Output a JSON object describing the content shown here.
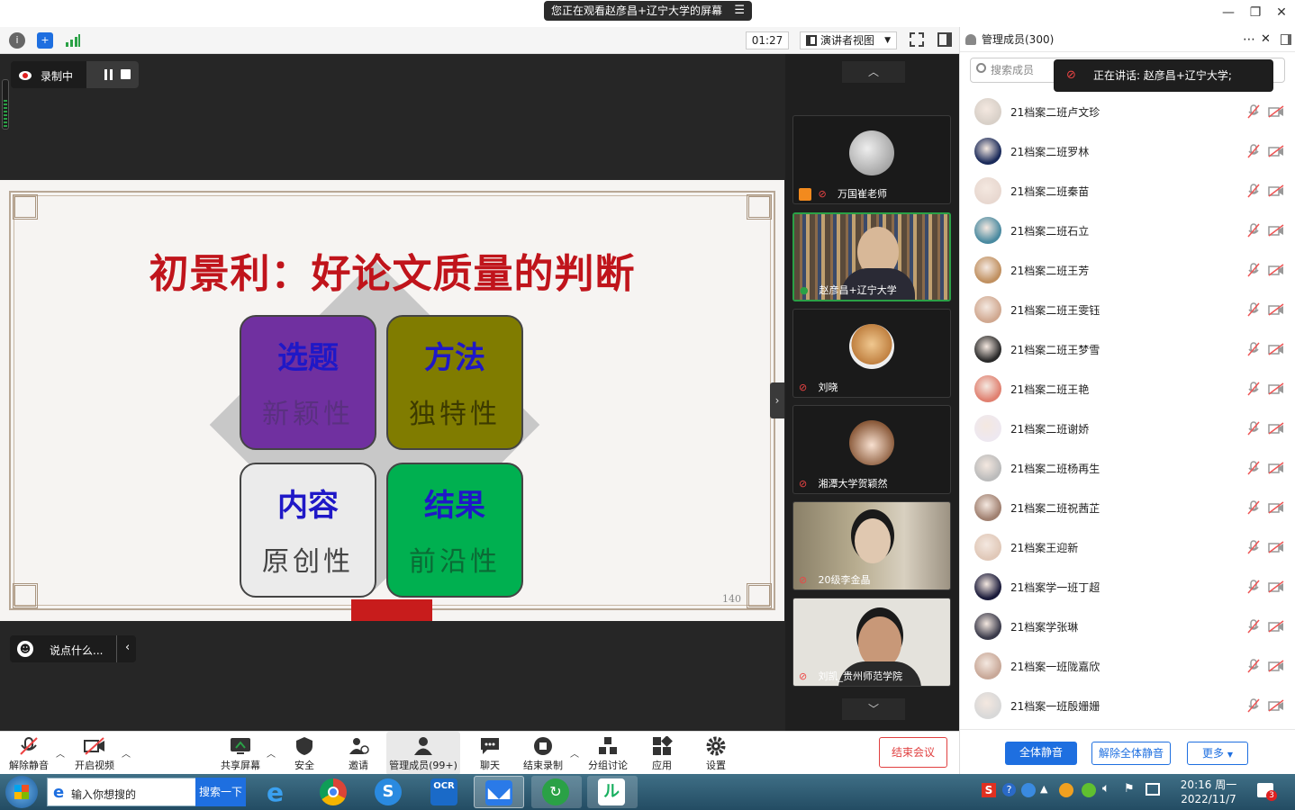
{
  "titlebar": {
    "share_banner": "您正在观看赵彦昌+辽宁大学的屏幕",
    "menu_icon": "list-icon",
    "min_icon": "minimize-icon",
    "restore_icon": "restore-icon",
    "close_icon": "close-icon"
  },
  "topbar": {
    "timer": "01:27",
    "view_label": "演讲者视图"
  },
  "recording": {
    "label": "录制中"
  },
  "slide": {
    "title": "初景利：好论文质量的判断",
    "page_number": "140",
    "quads": [
      {
        "heading": "选题",
        "sub": "新颖性",
        "bg": "#7030a0",
        "heading_color": "#1f18c7",
        "sub_color": "#5a3080"
      },
      {
        "heading": "方法",
        "sub": "独特性",
        "bg": "#807c00",
        "heading_color": "#1f18c7",
        "sub_color": "#3c3a00"
      },
      {
        "heading": "内容",
        "sub": "原创性",
        "bg": "#ebebeb",
        "heading_color": "#1f18c7",
        "sub_color": "#444444"
      },
      {
        "heading": "结果",
        "sub": "前沿性",
        "bg": "#00b050",
        "heading_color": "#1f18c7",
        "sub_color": "#0b6a35"
      }
    ]
  },
  "chat": {
    "placeholder": "说点什么..."
  },
  "tiles": [
    {
      "name": "万国崔老师"
    },
    {
      "name": "赵彦昌+辽宁大学"
    },
    {
      "name": "刘晓"
    },
    {
      "name": "湘潭大学贺颖然"
    },
    {
      "name": "20级李金晶"
    },
    {
      "name": "刘凯_贵州师范学院"
    }
  ],
  "panel": {
    "title": "管理成员(300)",
    "search_placeholder": "搜索成员",
    "speaking": "正在讲话: 赵彦昌+辽宁大学;",
    "participants": [
      "21档案二班卢文珍",
      "21档案二班罗林",
      "21档案二班秦苗",
      "21档案二班石立",
      "21档案二班王芳",
      "21档案二班王雯钰",
      "21档案二班王梦雪",
      "21档案二班王艳",
      "21档案二班谢娇",
      "21档案二班杨再生",
      "21档案二班祝茜芷",
      "21档案王迎新",
      "21档案学一班丁超",
      "21档案学张琳",
      "21档案一班陇嘉欣",
      "21档案一班殷姗姗"
    ],
    "btn_mute_all": "全体静音",
    "btn_unmute_all": "解除全体静音",
    "btn_more": "更多"
  },
  "bottombar": {
    "unmute": "解除静音",
    "start_video": "开启视频",
    "share_screen": "共享屏幕",
    "security": "安全",
    "invite": "邀请",
    "manage_members": "管理成员(99+)",
    "chat": "聊天",
    "end_recording": "结束录制",
    "breakout": "分组讨论",
    "apps": "应用",
    "settings": "设置",
    "end_meeting": "结束会议"
  },
  "taskbar": {
    "search_placeholder": "输入你想搜的",
    "search_button": "搜索一下",
    "clock_time": "20:16 周一",
    "clock_date": "2022/11/7",
    "notification_count": "3"
  }
}
